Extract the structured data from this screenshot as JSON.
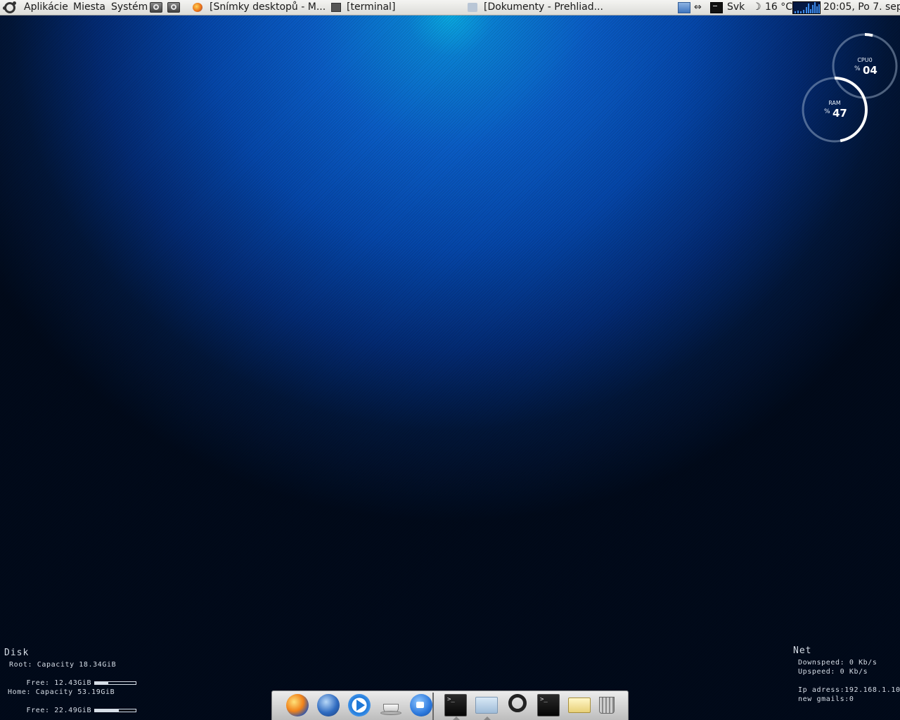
{
  "panel": {
    "menus": [
      "Aplikácie",
      "Miesta",
      "Systém"
    ],
    "tasks": [
      {
        "label": "[Snímky desktopů - M...",
        "icon": "firefox-icon"
      },
      {
        "label": "[terminal]",
        "icon": "terminal-icon"
      },
      {
        "label": "[Dokumenty - Prehliad...",
        "icon": "folder-icon"
      }
    ],
    "tray": {
      "arrows": "⇔",
      "keyboard_layout": "Svk",
      "weather_symbol": "☽",
      "temperature": "16 °C",
      "clock": "20:05, Po  7. sep"
    }
  },
  "meters": {
    "cpu": {
      "label": "CPU0",
      "unit": "%",
      "value": "04",
      "percent": 4
    },
    "ram": {
      "label": "RAM",
      "unit": "%",
      "value": "47",
      "percent": 47
    }
  },
  "disk": {
    "title": "Disk",
    "root_capacity": "Root: Capacity 18.34GiB",
    "root_free": "Free: 12.43GiB",
    "root_used_fraction": 0.32,
    "home_capacity": "Home: Capacity 53.19GiB",
    "home_free": "Free: 22.49GiB",
    "home_used_fraction": 0.58
  },
  "net": {
    "title": "Net",
    "downspeed": "Downspeed: 0 Kb/s",
    "upspeed": "Upspeed: 0 Kb/s",
    "ip": "Ip adress:192.168.1.10",
    "gmails": "new gmails:0"
  },
  "dock": {
    "items": [
      "firefox",
      "thunderbird",
      "media-player",
      "coffee-cup",
      "video-chat",
      "terminal",
      "window",
      "ubuntu",
      "terminal",
      "folder",
      "trash"
    ]
  },
  "colors": {
    "accent": "#0a5cc4",
    "text": "#d6dde6"
  }
}
